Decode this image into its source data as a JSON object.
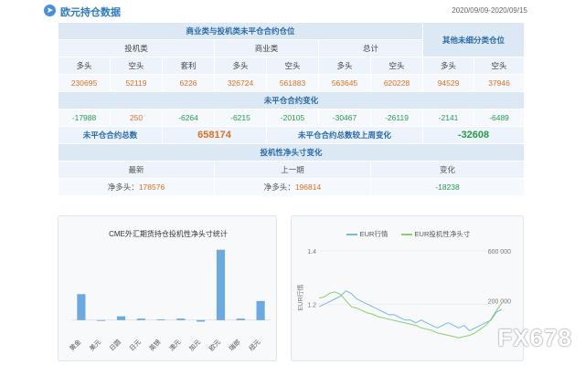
{
  "header": {
    "icon": "circle-arrow-icon",
    "title": "欧元持仓数据",
    "date_range": "2020/09/09-2020/09/15"
  },
  "table": {
    "group1": "商业类与投机类未平仓合约仓位",
    "other_group": "其他未细分类仓位",
    "spec": "投机类",
    "comm": "商业类",
    "total": "总计",
    "long": "多头",
    "short": "空头",
    "spread": "套利",
    "values": [
      "230695",
      "52119",
      "6226",
      "326724",
      "561883",
      "563645",
      "620228",
      "94529",
      "37946"
    ],
    "change_title": "未平仓合约变化",
    "changes": [
      "-17988",
      "250",
      "-6264",
      "-6215",
      "-20105",
      "-30467",
      "-26119",
      "-2141",
      "-6489"
    ],
    "oi_total_label": "未平仓合约总数",
    "oi_total": "658174",
    "oi_change_label": "未平仓合约总数较上周变化",
    "oi_change": "-32608",
    "net_title": "投机性净头寸变化",
    "latest": "最新",
    "prev": "上一期",
    "chg": "变化",
    "net_label": "净多头：",
    "net_latest": "178576",
    "net_prev": "196814",
    "net_chg": "-18238"
  },
  "colors": {
    "orange": "#e07020",
    "green": "#2a9a4a",
    "blue": "#2a6aa8",
    "bar": "#6aaae0",
    "line_blue": "#7ab8e0",
    "line_green": "#8ccf6a"
  },
  "chart_data": [
    {
      "type": "bar",
      "title": "CME外汇期货持仓投机性净头寸统计",
      "categories": [
        "黄金",
        "美元",
        "日圆",
        "日元",
        "英镑",
        "澳元",
        "加元",
        "欧元",
        "瑞郎",
        "纽元"
      ],
      "values": [
        34,
        -1,
        5,
        2,
        1,
        2,
        -2,
        92,
        2,
        25
      ],
      "ylim": [
        -5,
        100
      ]
    },
    {
      "type": "line",
      "series": [
        {
          "name": "EUR行情"
        },
        {
          "name": "EUR投机性净头寸"
        }
      ],
      "y_left_ticks": [
        "1.4",
        "1.2"
      ],
      "y_left_label": "EUR行情",
      "y_right_ticks": [
        "600 000",
        "200 000"
      ],
      "price": [
        1.19,
        1.2,
        1.21,
        1.22,
        1.23,
        1.25,
        1.24,
        1.22,
        1.21,
        1.2,
        1.19,
        1.18,
        1.17,
        1.16,
        1.16,
        1.15,
        1.14,
        1.14,
        1.13,
        1.14,
        1.13,
        1.12,
        1.11,
        1.12,
        1.13,
        1.12,
        1.11,
        1.12,
        1.1,
        1.11,
        1.12,
        1.13,
        1.14,
        1.17,
        1.18
      ],
      "net": [
        220000,
        230000,
        260000,
        270000,
        250000,
        200000,
        150000,
        140000,
        120000,
        100000,
        90000,
        70000,
        60000,
        50000,
        40000,
        30000,
        20000,
        10000,
        0,
        -20000,
        -30000,
        -40000,
        -60000,
        -70000,
        -80000,
        -90000,
        -100000,
        -90000,
        -80000,
        -60000,
        -30000,
        0,
        50000,
        120000,
        180000
      ]
    }
  ],
  "watermark": "FX678"
}
